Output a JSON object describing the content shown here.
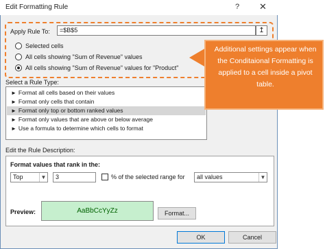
{
  "window": {
    "title": "Edit Formatting Rule",
    "help": "?",
    "close": "✕"
  },
  "apply": {
    "label": "Apply Rule To:",
    "value": "=$B$5",
    "collapse_icon": "↥",
    "options": [
      {
        "label": "Selected cells",
        "selected": false
      },
      {
        "label": "All cells showing \"Sum of Revenue\" values",
        "selected": false
      },
      {
        "label": "All cells showing \"Sum of Revenue\" values for \"Product\"",
        "selected": true
      }
    ]
  },
  "callout": {
    "text": "Additional settings appear when the Conditaional Formatting is applied to a cell inside a pivot table.",
    "color": "#ee7f2d"
  },
  "rule_type": {
    "label": "Select a Rule Type:",
    "items": [
      {
        "label": "Format all cells based on their values",
        "selected": false
      },
      {
        "label": "Format only cells that contain",
        "selected": false
      },
      {
        "label": "Format only top or bottom ranked values",
        "selected": true
      },
      {
        "label": "Format only values that are above or below average",
        "selected": false
      },
      {
        "label": "Use a formula to determine which cells to format",
        "selected": false
      }
    ]
  },
  "description": {
    "label": "Edit the Rule Description:",
    "heading": "Format values that rank in the:",
    "rank_select": "Top",
    "rank_value": "3",
    "percent_label": "% of the selected range for",
    "percent_checked": false,
    "scope_select": "all values",
    "preview_label": "Preview:",
    "preview_text": "AaBbCcYyZz",
    "preview_fill": "#c6efce",
    "format_button": "Format..."
  },
  "footer": {
    "ok": "OK",
    "cancel": "Cancel"
  }
}
